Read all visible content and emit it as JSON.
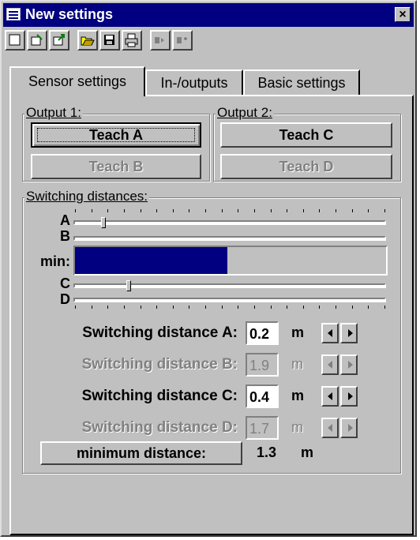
{
  "window": {
    "title": "New settings",
    "close_label": "×"
  },
  "toolbar": [
    {
      "name": "new-icon"
    },
    {
      "name": "edit-icon"
    },
    {
      "name": "export-icon"
    },
    {
      "name": "open-folder-icon"
    },
    {
      "name": "save-disk-icon"
    },
    {
      "name": "print-icon"
    },
    {
      "name": "send-icon"
    },
    {
      "name": "receive-icon"
    }
  ],
  "tabs": [
    {
      "label": "Sensor settings",
      "active": true
    },
    {
      "label": "In-/outputs",
      "active": false
    },
    {
      "label": "Basic settings",
      "active": false
    }
  ],
  "output1": {
    "label": "Output 1:",
    "teach_a": "Teach A",
    "teach_b": "Teach B"
  },
  "output2": {
    "label": "Output 2:",
    "teach_c": "Teach C",
    "teach_d": "Teach D"
  },
  "switching": {
    "label": "Switching distances:",
    "slider_labels": {
      "a": "A",
      "b": "B",
      "min": "min:",
      "c": "C",
      "d": "D"
    },
    "min_bar_fraction": 0.49,
    "slider_a_fraction": 0.085,
    "slider_c_fraction": 0.165,
    "rows": [
      {
        "label": "Switching distance A:",
        "value": "0.2",
        "unit": "m",
        "enabled": true
      },
      {
        "label": "Switching distance B:",
        "value": "1.9",
        "unit": "m",
        "enabled": false
      },
      {
        "label": "Switching distance C:",
        "value": "0.4",
        "unit": "m",
        "enabled": true
      },
      {
        "label": "Switching distance D:",
        "value": "1.7",
        "unit": "m",
        "enabled": false
      }
    ],
    "min_button": "minimum distance:",
    "min_value": "1.3",
    "min_unit": "m"
  }
}
